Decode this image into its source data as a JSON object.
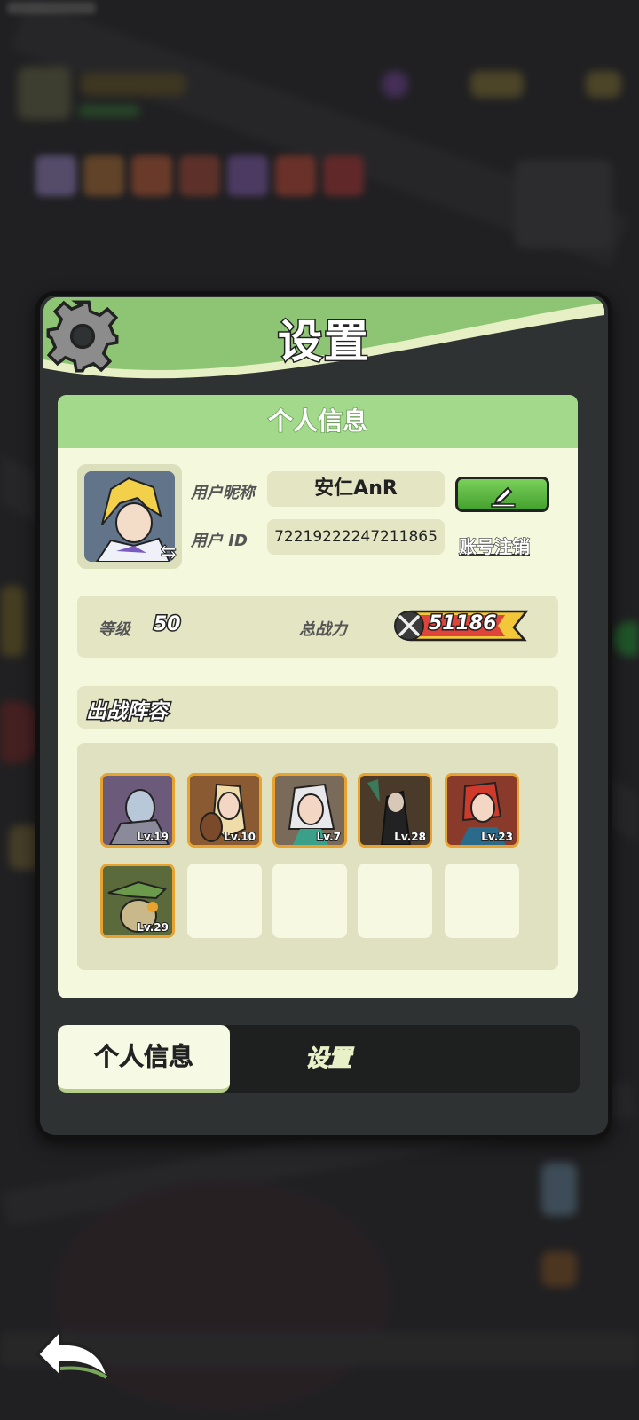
{
  "panel": {
    "title": "设置",
    "card_title": "个人信息"
  },
  "profile": {
    "nickname_label": "用户昵称",
    "nickname": "安仁AnR",
    "id_label": "用户 ID",
    "user_id": "72219222247211865",
    "cancel_account": "账号注销"
  },
  "stats": {
    "level_label": "等级",
    "level": "50",
    "power_label": "总战力",
    "power": "51186"
  },
  "team": {
    "title": "出战阵容",
    "heroes": [
      {
        "level": "Lv.19",
        "color": "#6b5a7a"
      },
      {
        "level": "Lv.10",
        "color": "#8a5a32"
      },
      {
        "level": "Lv.7",
        "color": "#7a6a5a"
      },
      {
        "level": "Lv.28",
        "color": "#4a3a2a"
      },
      {
        "level": "Lv.23",
        "color": "#8a3a2a"
      },
      {
        "level": "Lv.29",
        "color": "#5a6a3a"
      }
    ],
    "empty_slots": 4
  },
  "tabs": {
    "active": "个人信息",
    "inactive": "设置"
  },
  "icons": {
    "settings": "gear-icon",
    "edit": "pencil-icon",
    "swap": "swap-icon",
    "power": "crossed-swords-icon",
    "back": "back-arrow-icon"
  },
  "colors": {
    "header_green": "#8ec574",
    "card_bg": "#f4f8dd",
    "button_green": "#5bb83e",
    "hero_border": "#e8a230"
  }
}
